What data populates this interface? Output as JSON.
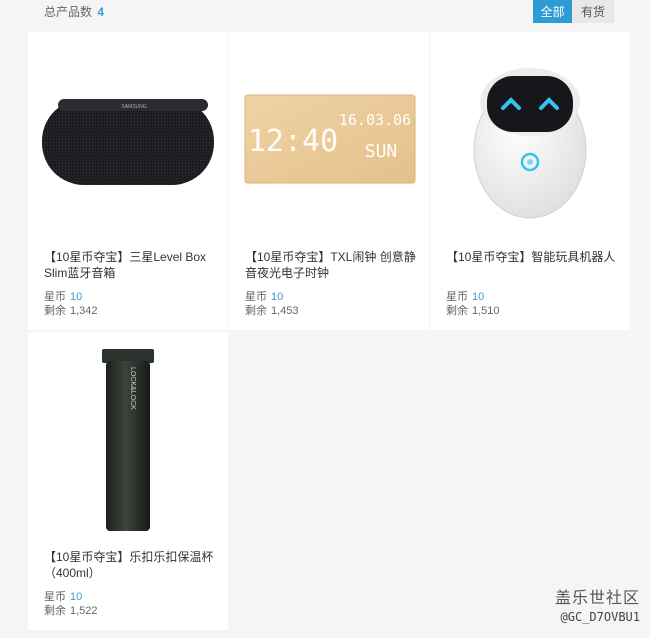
{
  "header": {
    "total_label": "总产品数",
    "total_count": "4",
    "filters": [
      {
        "label": "全部",
        "active": true
      },
      {
        "label": "有货",
        "active": false
      }
    ]
  },
  "products": [
    {
      "title": "【10星币夺宝】三星Level Box Slim蓝牙音箱",
      "price_label": "星币",
      "price": "10",
      "stock_label": "剩余",
      "stock": "1,342",
      "image": "speaker-image"
    },
    {
      "title": "【10星币夺宝】TXL闹钟 创意静音夜光电子时钟",
      "price_label": "星币",
      "price": "10",
      "stock_label": "剩余",
      "stock": "1,453",
      "image": "clock-image",
      "clock_time": "12:40",
      "clock_date": "16.03.06",
      "clock_day": "SUN"
    },
    {
      "title": "【10星币夺宝】智能玩具机器人",
      "price_label": "星币",
      "price": "10",
      "stock_label": "剩余",
      "stock": "1,510",
      "image": "robot-image"
    },
    {
      "title": "【10星币夺宝】乐扣乐扣保温杯（400ml）",
      "price_label": "星币",
      "price": "10",
      "stock_label": "剩余",
      "stock": "1,522",
      "image": "thermos-image",
      "brand_text": "LOCK&LOCK"
    }
  ],
  "watermark": {
    "line1": "盖乐世社区",
    "line2": "@GC_D7OVBU1"
  },
  "colors": {
    "accent": "#2f9bd5",
    "background": "#f5f5f5"
  }
}
